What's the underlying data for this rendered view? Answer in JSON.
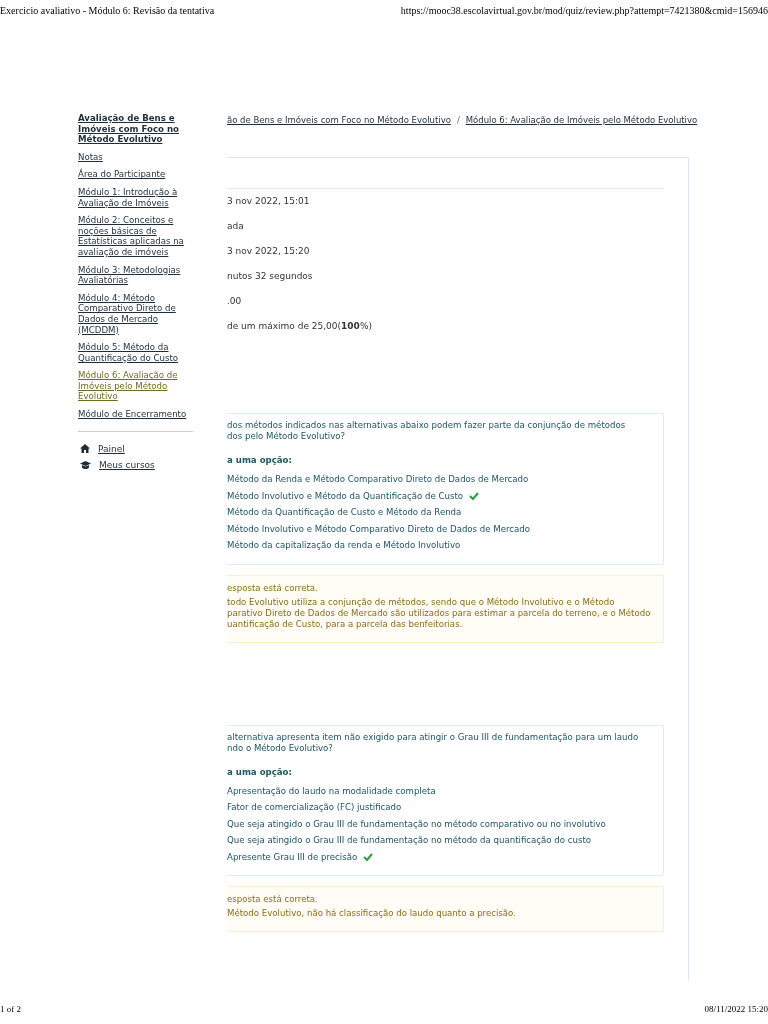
{
  "header": {
    "title": "Exercicio avaliativo - Módulo 6: Revisão da tentativa",
    "url": "https://mooc38.escolavirtual.gov.br/mod/quiz/review.php?attempt=7421380&cmid=156946"
  },
  "sidebar": {
    "course_link": "Avaliação de Bens e Imóveis com Foco no Método Evolutivo",
    "items": [
      {
        "label": "Notas",
        "selected": false
      },
      {
        "label": "Área do Participante",
        "selected": false
      },
      {
        "label": "Módulo 1: Introdução à Avaliação de Imóveis",
        "selected": false
      },
      {
        "label": "Módulo 2: Conceitos e noções básicas de Estatísticas aplicadas na avaliação de imóveis",
        "selected": false
      },
      {
        "label": "Módulo 3: Metodologias Avaliatórias",
        "selected": false
      },
      {
        "label": "Módulo 4: Método Comparativo Direto de Dados de Mercado (MCDDM)",
        "selected": false
      },
      {
        "label": "Módulo 5: Método da Quantificação do Custo",
        "selected": false
      },
      {
        "label": "Módulo 6: Avaliação de Imóveis pelo Método Evolutivo",
        "selected": true
      },
      {
        "label": "Módulo de Encerramento",
        "selected": false
      }
    ],
    "nav": [
      {
        "label": "Painel",
        "kind": "home"
      },
      {
        "label": "Meus cursos",
        "kind": "courses"
      }
    ]
  },
  "breadcrumb": {
    "items": [
      "ão de Bens e Imóveis com Foco no Método Evolutivo",
      "Módulo 6: Avaliação de Imóveis pelo Método Evolutivo"
    ],
    "separator": "/"
  },
  "summary": [
    "3 nov 2022, 15:01",
    "ada",
    "3 nov 2022, 15:20",
    "nutos 32 segundos",
    ".00",
    "de um máximo de 25,00(**100**%)"
  ],
  "questions": [
    {
      "text": "dos métodos indicados nas alternativas abaixo podem fazer parte da conjunção de métodos\ndos pelo Método Evolutivo?",
      "prompt": "a uma opção:",
      "options": [
        {
          "text": "Método da Renda e Método Comparativo Direto de Dados de Mercado",
          "correct": false
        },
        {
          "text": "Método Involutivo e Método da Quantificação de Custo",
          "correct": true
        },
        {
          "text": "Método da Quantificação de Custo e Método da Renda",
          "correct": false
        },
        {
          "text": "Método Involutivo e Método Comparativo Direto de Dados de Mercado",
          "correct": false
        },
        {
          "text": "Método da capitalização da renda e Método Involutivo",
          "correct": false
        }
      ],
      "feedback": {
        "status": "esposta está correta.",
        "explanation": "todo Evolutivo utiliza a conjunção de métodos, sendo que o Método Involutivo e o Método\nparativo Direto de Dados de Mercado são utilizados para estimar a parcela do terreno, e o Método\nuantificação de Custo, para a parcela das benfeitorias."
      }
    },
    {
      "text": "alternativa apresenta item não exigido para atingir o Grau III de fundamentação para um laudo\nndo o Método Evolutivo?",
      "prompt": "a uma opção:",
      "options": [
        {
          "text": "Apresentação do laudo na modalidade completa",
          "correct": false
        },
        {
          "text": "Fator de comercialização (FC) justificado",
          "correct": false
        },
        {
          "text": "Que seja atingido o Grau III de fundamentação no método comparativo ou no involutivo",
          "correct": false
        },
        {
          "text": "Que seja atingido o Grau III de fundamentação no método da quantificação do custo",
          "correct": false
        },
        {
          "text": "Apresente Grau III de precisão",
          "correct": true
        }
      ],
      "feedback": {
        "status": "esposta está correta.",
        "explanation": "Método Evolutivo, não há classificação do laudo quanto a precisão."
      }
    }
  ],
  "footer": {
    "page": "1 of 2",
    "date": "08/11/2022 15:20"
  }
}
